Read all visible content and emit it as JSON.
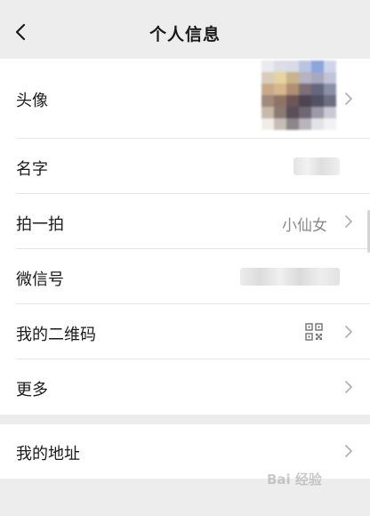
{
  "header": {
    "title": "个人信息"
  },
  "rows": {
    "avatar": {
      "label": "头像"
    },
    "name": {
      "label": "名字"
    },
    "pat": {
      "label": "拍一拍",
      "value": "小仙女"
    },
    "wechat_id": {
      "label": "微信号"
    },
    "qr_code": {
      "label": "我的二维码"
    },
    "more": {
      "label": "更多"
    },
    "address": {
      "label": "我的地址"
    }
  },
  "watermark": {
    "text": "Bai 经验"
  },
  "colors": {
    "background": "#ededed",
    "card": "#ffffff",
    "chevron": "#b2b2b2"
  }
}
